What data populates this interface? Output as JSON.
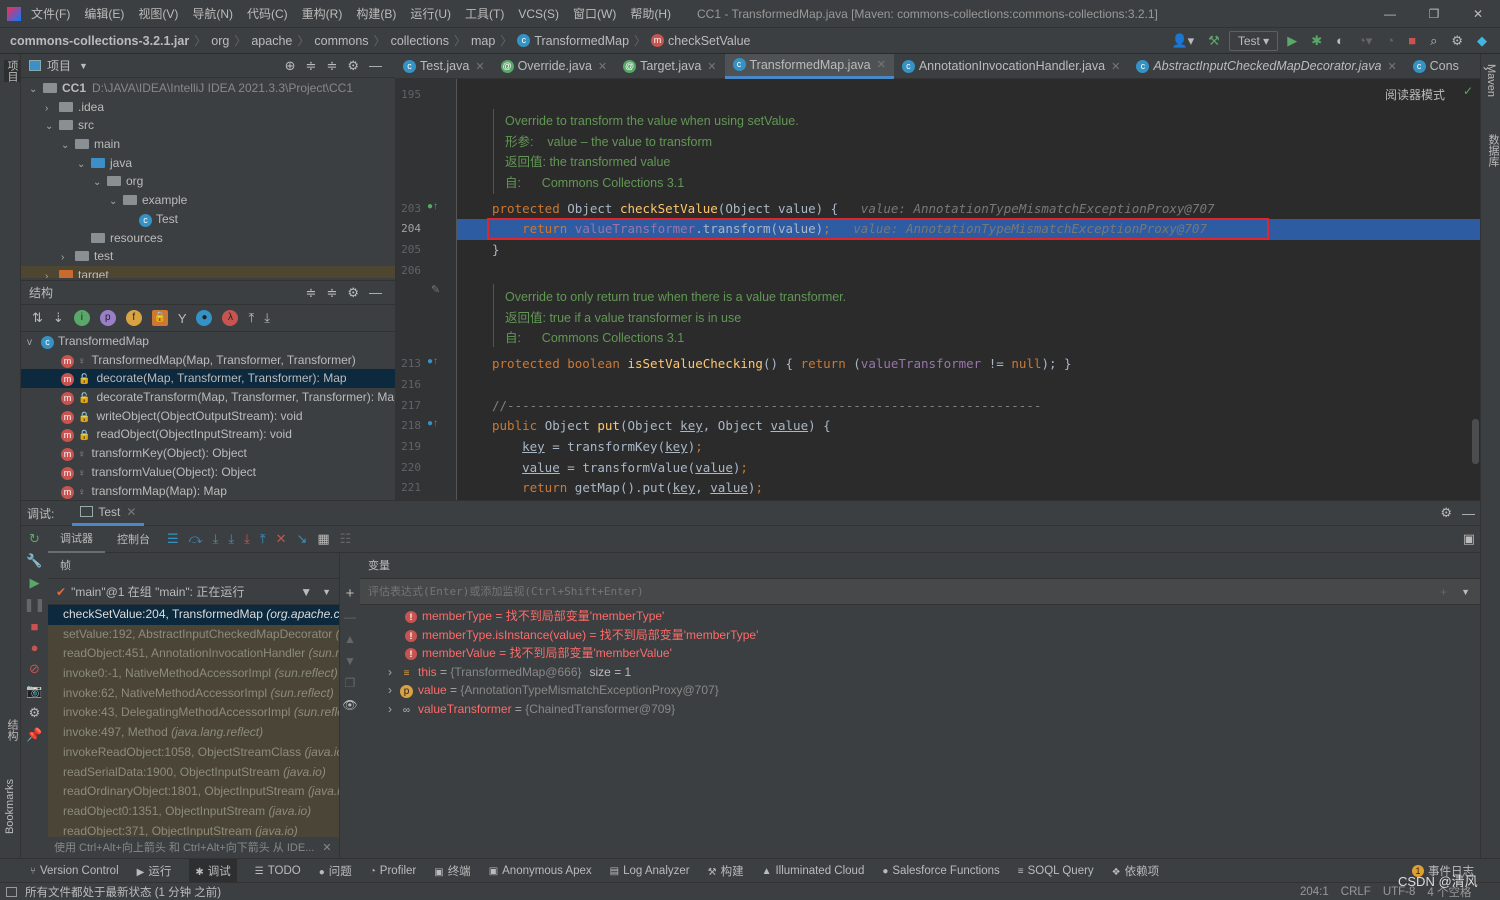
{
  "titlebar": {
    "menus": [
      "文件(F)",
      "编辑(E)",
      "视图(V)",
      "导航(N)",
      "代码(C)",
      "重构(R)",
      "构建(B)",
      "运行(U)",
      "工具(T)",
      "VCS(S)",
      "窗口(W)",
      "帮助(H)"
    ],
    "title": "CC1 - TransformedMap.java [Maven: commons-collections:commons-collections:3.2.1]"
  },
  "breadcrumb": [
    "commons-collections-3.2.1.jar",
    "org",
    "apache",
    "commons",
    "collections",
    "map",
    "TransformedMap",
    "checkSetValue"
  ],
  "run_config": "Test",
  "left_strip": {
    "project": "项目",
    "structure": "结构",
    "bookmarks": "Bookmarks"
  },
  "right_strip": {
    "maven": "Maven",
    "database": "数据库"
  },
  "project": {
    "title": "项目",
    "items": [
      {
        "label": "CC1",
        "path": "D:\\JAVA\\IDEA\\IntelliJ IDEA 2021.3.3\\Project\\CC1",
        "depth": 0,
        "arrow": "v"
      },
      {
        "label": ".idea",
        "depth": 1,
        "arrow": ">"
      },
      {
        "label": "src",
        "depth": 1,
        "arrow": "v"
      },
      {
        "label": "main",
        "depth": 2,
        "arrow": "v"
      },
      {
        "label": "java",
        "depth": 3,
        "arrow": "v"
      },
      {
        "label": "org",
        "depth": 4,
        "arrow": "v"
      },
      {
        "label": "example",
        "depth": 5,
        "arrow": "v"
      },
      {
        "label": "Test",
        "depth": 6,
        "arrow": ""
      },
      {
        "label": "resources",
        "depth": 3,
        "arrow": ""
      },
      {
        "label": "test",
        "depth": 2,
        "arrow": ">"
      },
      {
        "label": "target",
        "depth": 1,
        "arrow": ">"
      }
    ]
  },
  "structure": {
    "title": "结构",
    "root": "TransformedMap",
    "items": [
      {
        "label": "TransformedMap(Map, Transformer, Transformer)",
        "access": "package"
      },
      {
        "label": "decorate(Map, Transformer, Transformer): Map",
        "access": "public",
        "selected": true
      },
      {
        "label": "decorateTransform(Map, Transformer, Transformer): Map",
        "access": "public"
      },
      {
        "label": "writeObject(ObjectOutputStream): void",
        "access": "private"
      },
      {
        "label": "readObject(ObjectInputStream): void",
        "access": "private"
      },
      {
        "label": "transformKey(Object): Object",
        "access": "package"
      },
      {
        "label": "transformValue(Object): Object",
        "access": "package"
      },
      {
        "label": "transformMap(Map): Map",
        "access": "package"
      }
    ]
  },
  "editor": {
    "tabs": [
      {
        "label": "Test.java"
      },
      {
        "label": "Override.java"
      },
      {
        "label": "Target.java"
      },
      {
        "label": "TransformedMap.java",
        "active": true
      },
      {
        "label": "AnnotationInvocationHandler.java"
      },
      {
        "label": "AbstractInputCheckedMapDecorator.java",
        "italic": true
      },
      {
        "label": "Cons"
      }
    ],
    "reader_mode": "阅读器模式",
    "line_numbers": [
      "195",
      "203",
      "204",
      "205",
      "206",
      "213",
      "216",
      "217",
      "218",
      "219",
      "220",
      "221"
    ],
    "doc1": [
      "Override to transform the value when using setValue.",
      "形参:    value – the value to transform",
      "返回值: the transformed value",
      "自:      Commons Collections 3.1"
    ],
    "doc2": [
      "Override to only return true when there is a value transformer.",
      "返回值: true if a value transformer is in use",
      "自:      Commons Collections 3.1"
    ],
    "code": [
      [
        [
          "protected ",
          "kw"
        ],
        [
          "Object ",
          ""
        ],
        [
          "checkSetValue",
          "fn"
        ],
        [
          "(Object value) {   ",
          ""
        ],
        [
          "value: AnnotationTypeMismatchExceptionProxy@707",
          "hint"
        ]
      ],
      [
        [
          "    return ",
          "kw"
        ],
        [
          "valueTransformer",
          "fld"
        ],
        [
          ".transform(value)",
          ""
        ],
        [
          ";",
          "kw"
        ],
        [
          "   value: AnnotationTypeMismatchExceptionProxy@707",
          "hint"
        ]
      ],
      [
        [
          "}",
          ""
        ]
      ],
      [
        [
          "",
          ""
        ]
      ],
      [
        [
          "protected boolean ",
          "kw"
        ],
        [
          "isSetValueChecking",
          "fn"
        ],
        [
          "() { ",
          ""
        ],
        [
          "return ",
          "kw"
        ],
        [
          "(",
          ""
        ],
        [
          "valueTransformer",
          "fld"
        ],
        [
          " != ",
          ""
        ],
        [
          "null",
          "kw"
        ],
        [
          "); }",
          ""
        ]
      ],
      [
        [
          "",
          ""
        ]
      ],
      [
        [
          "//-----------------------------------------------------------------------",
          "cm"
        ]
      ],
      [
        [
          "public ",
          "kw"
        ],
        [
          "Object ",
          ""
        ],
        [
          "put",
          "fn"
        ],
        [
          "(Object ",
          ""
        ],
        [
          "key",
          "ul"
        ],
        [
          ", Object ",
          ""
        ],
        [
          "value",
          "ul"
        ],
        [
          ") {",
          ""
        ]
      ],
      [
        [
          "    ",
          ""
        ],
        [
          "key",
          "ul"
        ],
        [
          " = transformKey(",
          ""
        ],
        [
          "key",
          "ul"
        ],
        [
          ")",
          ""
        ],
        [
          ";",
          "kw"
        ]
      ],
      [
        [
          "    ",
          ""
        ],
        [
          "value",
          "ul"
        ],
        [
          " = transformValue(",
          ""
        ],
        [
          "value",
          "ul"
        ],
        [
          ")",
          ""
        ],
        [
          ";",
          "kw"
        ]
      ],
      [
        [
          "    return ",
          "kw"
        ],
        [
          "getMap().put(",
          ""
        ],
        [
          "key",
          "ul"
        ],
        [
          ", ",
          ""
        ],
        [
          "value",
          "ul"
        ],
        [
          ")",
          ""
        ],
        [
          ";",
          "kw"
        ]
      ]
    ]
  },
  "debug": {
    "label": "调试:",
    "session": "Test",
    "tabs": [
      "调试器",
      "控制台"
    ],
    "frames_title": "帧",
    "vars_title": "变量",
    "thread": "\"main\"@1 在组 \"main\": 正在运行",
    "frames": [
      {
        "method": "checkSetValue:204, TransformedMap",
        "pkg": "(org.apache.commons.collections.map)"
      },
      {
        "method": "setValue:192, AbstractInputCheckedMapDecorator",
        "pkg": "(org.apache.commons.collections.map)"
      },
      {
        "method": "readObject:451, AnnotationInvocationHandler",
        "pkg": "(sun.reflect.annotation)"
      },
      {
        "method": "invoke0:-1, NativeMethodAccessorImpl",
        "pkg": "(sun.reflect)"
      },
      {
        "method": "invoke:62, NativeMethodAccessorImpl",
        "pkg": "(sun.reflect)"
      },
      {
        "method": "invoke:43, DelegatingMethodAccessorImpl",
        "pkg": "(sun.reflect)"
      },
      {
        "method": "invoke:497, Method",
        "pkg": "(java.lang.reflect)"
      },
      {
        "method": "invokeReadObject:1058, ObjectStreamClass",
        "pkg": "(java.io)"
      },
      {
        "method": "readSerialData:1900, ObjectInputStream",
        "pkg": "(java.io)"
      },
      {
        "method": "readOrdinaryObject:1801, ObjectInputStream",
        "pkg": "(java.io)"
      },
      {
        "method": "readObject0:1351, ObjectInputStream",
        "pkg": "(java.io)"
      },
      {
        "method": "readObject:371, ObjectInputStream",
        "pkg": "(java.io)"
      }
    ],
    "hint": "使用 Ctrl+Alt+向上箭头 和 Ctrl+Alt+向下箭头 从 IDE...",
    "eval_placeholder": "评估表达式(Enter)或添加监视(Ctrl+Shift+Enter)",
    "watches": [
      {
        "name": "memberType",
        "value": "找不到局部变量'memberType'"
      },
      {
        "name": "memberType.isInstance(value)",
        "value": "找不到局部变量'memberType'"
      },
      {
        "name": "memberValue",
        "value": "找不到局部变量'memberValue'"
      }
    ],
    "vars": [
      {
        "name": "this",
        "value": "{TransformedMap@666}",
        "extra": "size = 1",
        "icon": "fields-icon"
      },
      {
        "name": "value",
        "value": "{AnnotationTypeMismatchExceptionProxy@707}",
        "extra": "",
        "icon": "parameter-icon"
      },
      {
        "name": "valueTransformer",
        "value": "{ChainedTransformer@709}",
        "extra": "",
        "icon": "watch-glasses-icon"
      }
    ]
  },
  "bottom_tools": [
    "Version Control",
    "运行",
    "调试",
    "TODO",
    "问题",
    "Profiler",
    "终端",
    "Anonymous Apex",
    "Log Analyzer",
    "构建",
    "Illuminated Cloud",
    "Salesforce Functions",
    "SOQL Query",
    "依赖项"
  ],
  "event_log": "事件日志",
  "event_count": "1",
  "status": {
    "message": "所有文件都处于最新状态 (1 分钟 之前)",
    "position": "204:1",
    "line_sep": "CRLF",
    "encoding": "UTF-8",
    "indent": "4 个空格",
    "watermark": "CSDN @清风"
  }
}
